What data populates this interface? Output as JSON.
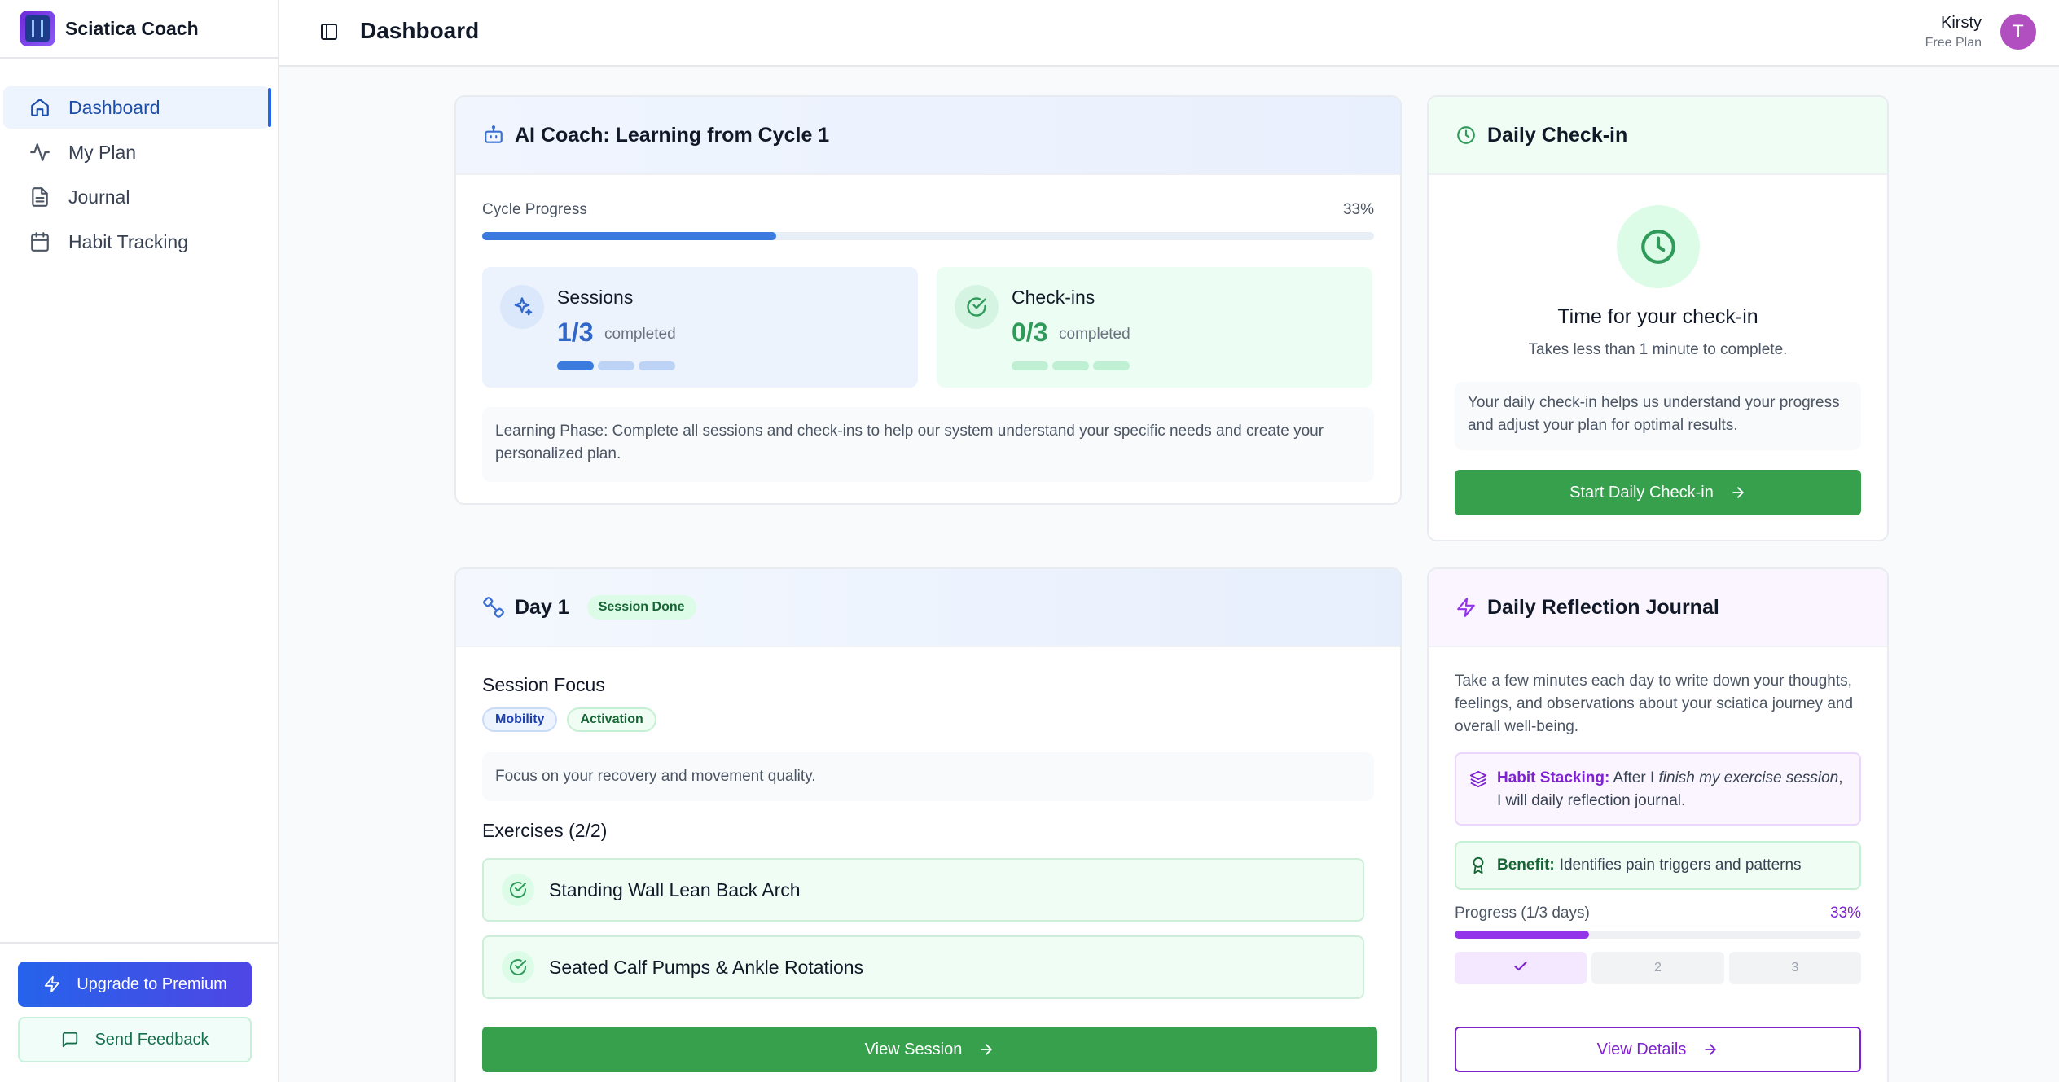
{
  "app": {
    "name": "Sciatica Coach"
  },
  "sidebar": {
    "items": [
      {
        "label": "Dashboard",
        "icon": "home-icon"
      },
      {
        "label": "My Plan",
        "icon": "activity-icon"
      },
      {
        "label": "Journal",
        "icon": "file-text-icon"
      },
      {
        "label": "Habit Tracking",
        "icon": "calendar-icon"
      }
    ],
    "upgrade_label": "Upgrade to Premium",
    "feedback_label": "Send Feedback"
  },
  "header": {
    "title": "Dashboard",
    "user_name": "Kirsty",
    "user_plan": "Free Plan",
    "avatar_initial": "T"
  },
  "ai_coach": {
    "title": "AI Coach: Learning from Cycle 1",
    "progress_label": "Cycle Progress",
    "progress_percent_text": "33%",
    "progress_fraction": 0.33,
    "sessions": {
      "label": "Sessions",
      "value": "1/3",
      "sub": "completed",
      "done": 1,
      "total": 3
    },
    "checkins": {
      "label": "Check-ins",
      "value": "0/3",
      "sub": "completed",
      "done": 0,
      "total": 3
    },
    "note": "Learning Phase: Complete all sessions and check-ins to help our system understand your specific needs and create your personalized plan."
  },
  "daily_checkin": {
    "title": "Daily Check-in",
    "heading": "Time for your check-in",
    "sub": "Takes less than 1 minute to complete.",
    "note": "Your daily check-in helps us understand your progress and adjust your plan for optimal results.",
    "button_label": "Start Daily Check-in"
  },
  "day": {
    "title": "Day 1",
    "badge": "Session Done",
    "focus_title": "Session Focus",
    "tags": [
      "Mobility",
      "Activation"
    ],
    "focus_note": "Focus on your recovery and movement quality.",
    "exercises_title": "Exercises (2/2)",
    "exercises": [
      "Standing Wall Lean Back Arch",
      "Seated Calf Pumps & Ankle Rotations"
    ],
    "button_label": "View Session"
  },
  "journal": {
    "title": "Daily Reflection Journal",
    "description": "Take a few minutes each day to write down your thoughts, feelings, and observations about your sciatica journey and overall well-being.",
    "habit_label": "Habit Stacking:",
    "habit_text_1": "After I",
    "habit_text_em": "finish my exercise session",
    "habit_text_2": ", I will daily reflection journal.",
    "benefit_label": "Benefit:",
    "benefit_text": "Identifies pain triggers and patterns",
    "progress_label": "Progress (1/3 days)",
    "progress_percent_text": "33%",
    "progress_fraction": 0.33,
    "days": [
      "",
      "2",
      "3"
    ],
    "button_label": "View Details"
  },
  "colors": {
    "primary_blue": "#2563eb",
    "green": "#36a04d",
    "purple": "#7e22ce"
  }
}
